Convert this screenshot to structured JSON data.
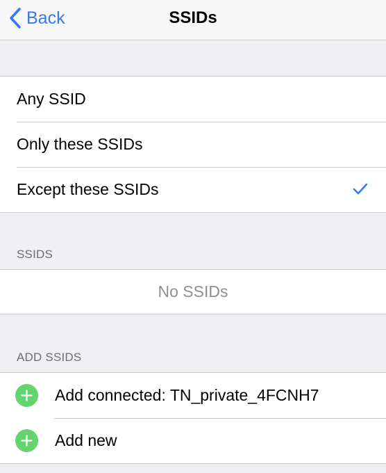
{
  "navbar": {
    "back_label": "Back",
    "title": "SSIDs"
  },
  "mode": {
    "options": [
      "Any SSID",
      "Only these SSIDs",
      "Except these SSIDs"
    ],
    "selected": "Except these SSIDs"
  },
  "ssids_section": {
    "header": "SSIDS",
    "empty_text": "No SSIDs"
  },
  "add_section": {
    "header": "ADD SSIDS",
    "items": [
      "Add connected: TN_private_4FCNH7",
      "Add new"
    ]
  },
  "colors": {
    "tint": "#3478f6",
    "add_green": "#65d36e",
    "background": "#efeff4"
  }
}
